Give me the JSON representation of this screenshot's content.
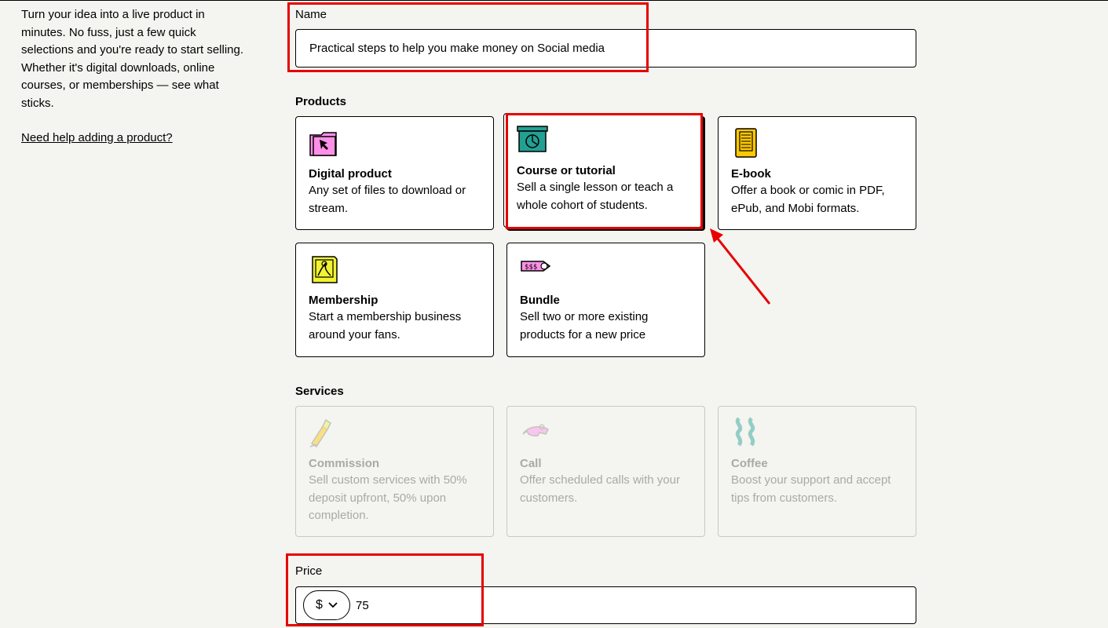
{
  "sidebar": {
    "intro": "Turn your idea into a live product in minutes. No fuss, just a few quick selections and you're ready to start selling. Whether it's digital downloads, online courses, or memberships — see what sticks.",
    "help_link": "Need help adding a product?"
  },
  "name_field": {
    "label": "Name",
    "value": "Practical steps to help you make money on Social media"
  },
  "products": {
    "heading": "Products",
    "items": [
      {
        "title": "Digital product",
        "description": "Any set of files to download or stream.",
        "icon": "digital-product-icon"
      },
      {
        "title": "Course or tutorial",
        "description": "Sell a single lesson or teach a whole cohort of students.",
        "icon": "course-icon",
        "selected": true
      },
      {
        "title": "E-book",
        "description": "Offer a book or comic in PDF, ePub, and Mobi formats.",
        "icon": "ebook-icon"
      },
      {
        "title": "Membership",
        "description": "Start a membership business around your fans.",
        "icon": "membership-icon"
      },
      {
        "title": "Bundle",
        "description": "Sell two or more existing products for a new price",
        "icon": "bundle-icon"
      }
    ]
  },
  "services": {
    "heading": "Services",
    "items": [
      {
        "title": "Commission",
        "description": "Sell custom services with 50% deposit upfront, 50% upon completion.",
        "icon": "commission-icon",
        "disabled": true
      },
      {
        "title": "Call",
        "description": "Offer scheduled calls with your customers.",
        "icon": "call-icon",
        "disabled": true
      },
      {
        "title": "Coffee",
        "description": "Boost your support and accept tips from customers.",
        "icon": "coffee-icon",
        "disabled": true
      }
    ]
  },
  "price_field": {
    "label": "Price",
    "currency": "$",
    "value": "75"
  },
  "colors": {
    "background": "#f4f4f0",
    "annotation_red": "#e60000",
    "pink": "#ff90e8",
    "teal": "#23a094",
    "yellow": "#ffc900",
    "lime": "#f1f333"
  }
}
